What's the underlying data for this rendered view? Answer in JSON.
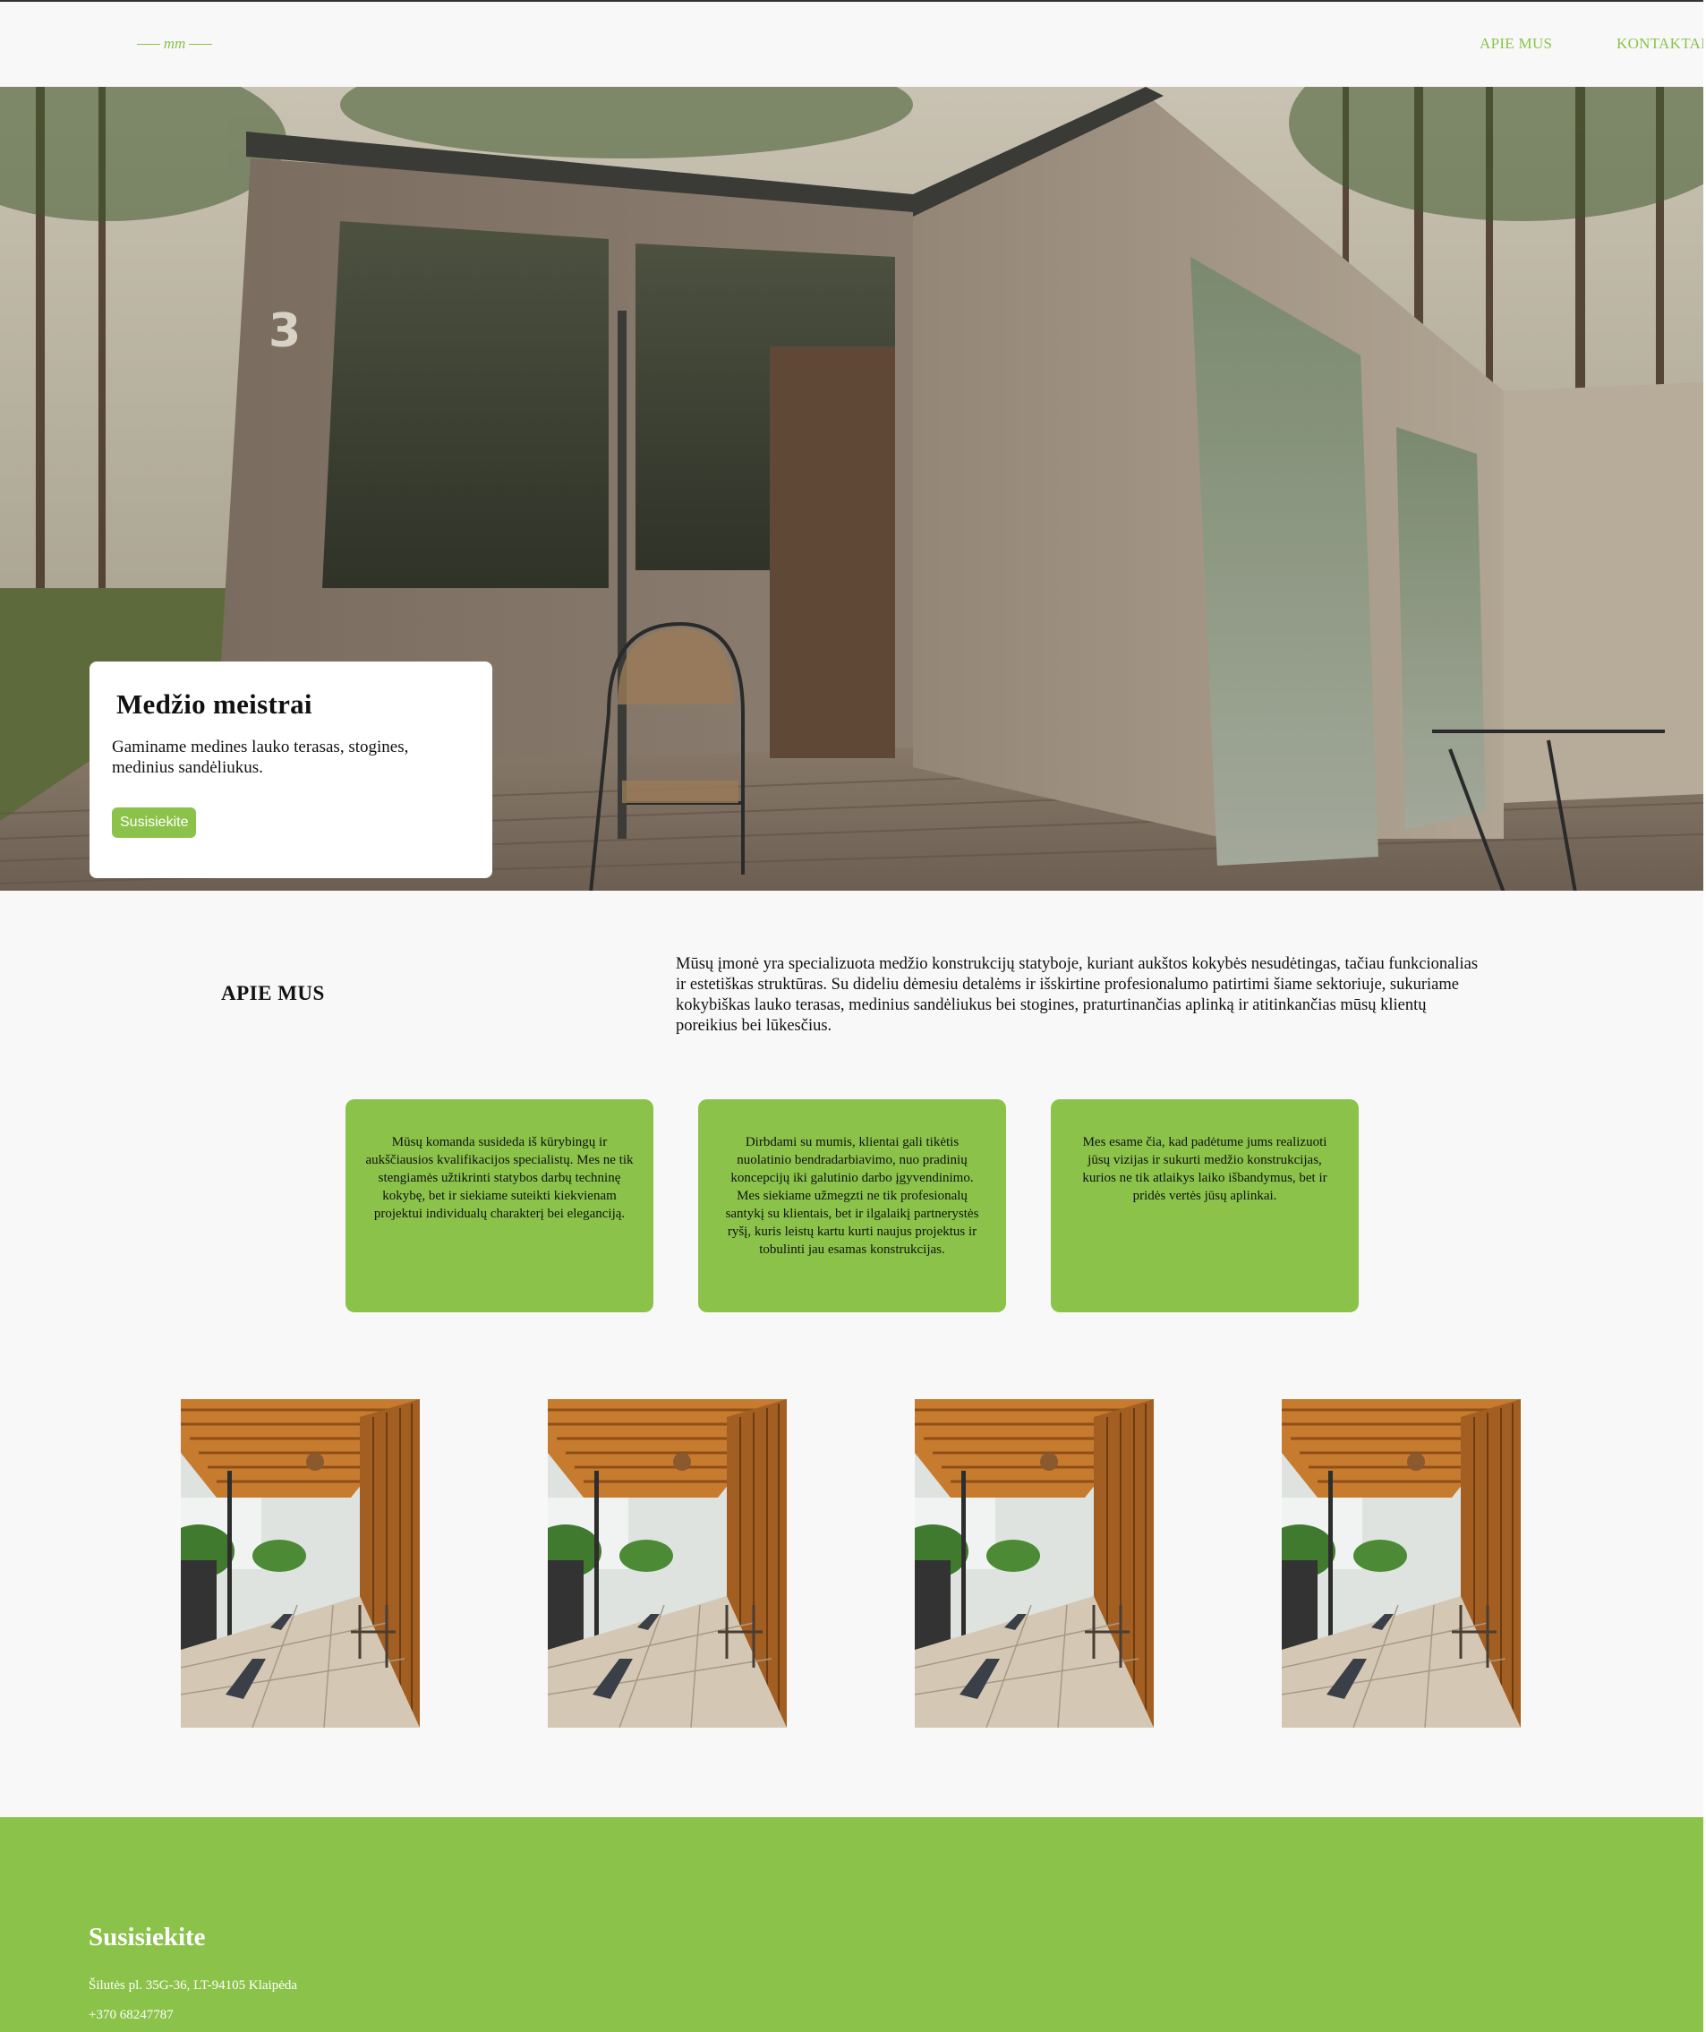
{
  "header": {
    "logo_text": "mm",
    "nav": [
      "APIE MUS",
      "KONTAKTAI"
    ]
  },
  "hero": {
    "title": "Medžio meistrai",
    "subtitle": "Gaminame medines lauko terasas, stogines, medinius sandėliukus.",
    "button_label": "Susisiekite",
    "cabin_number": "3"
  },
  "about": {
    "title": "APIE MUS",
    "text": "Mūsų įmonė yra specializuota medžio konstrukcijų statyboje, kuriant aukštos kokybės nesudėtingas, tačiau funkcionalias ir estetiškas struktūras. Su dideliu dėmesiu detalėms ir išskirtine profesionalumo patirtimi šiame sektoriuje, sukuriame kokybiškas lauko terasas, medinius sandėliukus bei stogines, praturtinančias aplinką ir atitinkančias mūsų klientų poreikius bei lūkesčius."
  },
  "cards": [
    "Mūsų komanda susideda iš kūrybingų ir aukščiausios kvalifikacijos specialistų. Mes ne tik stengiamės užtikrinti statybos darbų techninę kokybę, bet ir siekiame suteikti kiekvienam projektui individualų charakterį bei eleganciją.",
    "Dirbdami su mumis, klientai gali tikėtis nuolatinio bendradarbiavimo, nuo pradinių koncepcijų iki galutinio darbo įgyvendinimo. Mes siekiame užmegzti ne tik profesionalų santykį su klientais, bet ir ilgalaikį partnerystės ryšį, kuris leistų kartu kurti naujus projektus ir tobulinti jau esamas konstrukcijas.",
    "Mes esame čia, kad padėtume jums realizuoti jūsų vizijas ir sukurti medžio konstrukcijas, kurios ne tik atlaikys laiko išbandymus, bet ir pridės vertės jūsų aplinkai."
  ],
  "footer": {
    "title": "Susisiekite",
    "address": "Šilutės pl. 35G-36, LT-94105 Klaipėda",
    "phone": "+370 68247787"
  },
  "colors": {
    "accent": "#8bc34a",
    "background": "#f8f8f8"
  }
}
